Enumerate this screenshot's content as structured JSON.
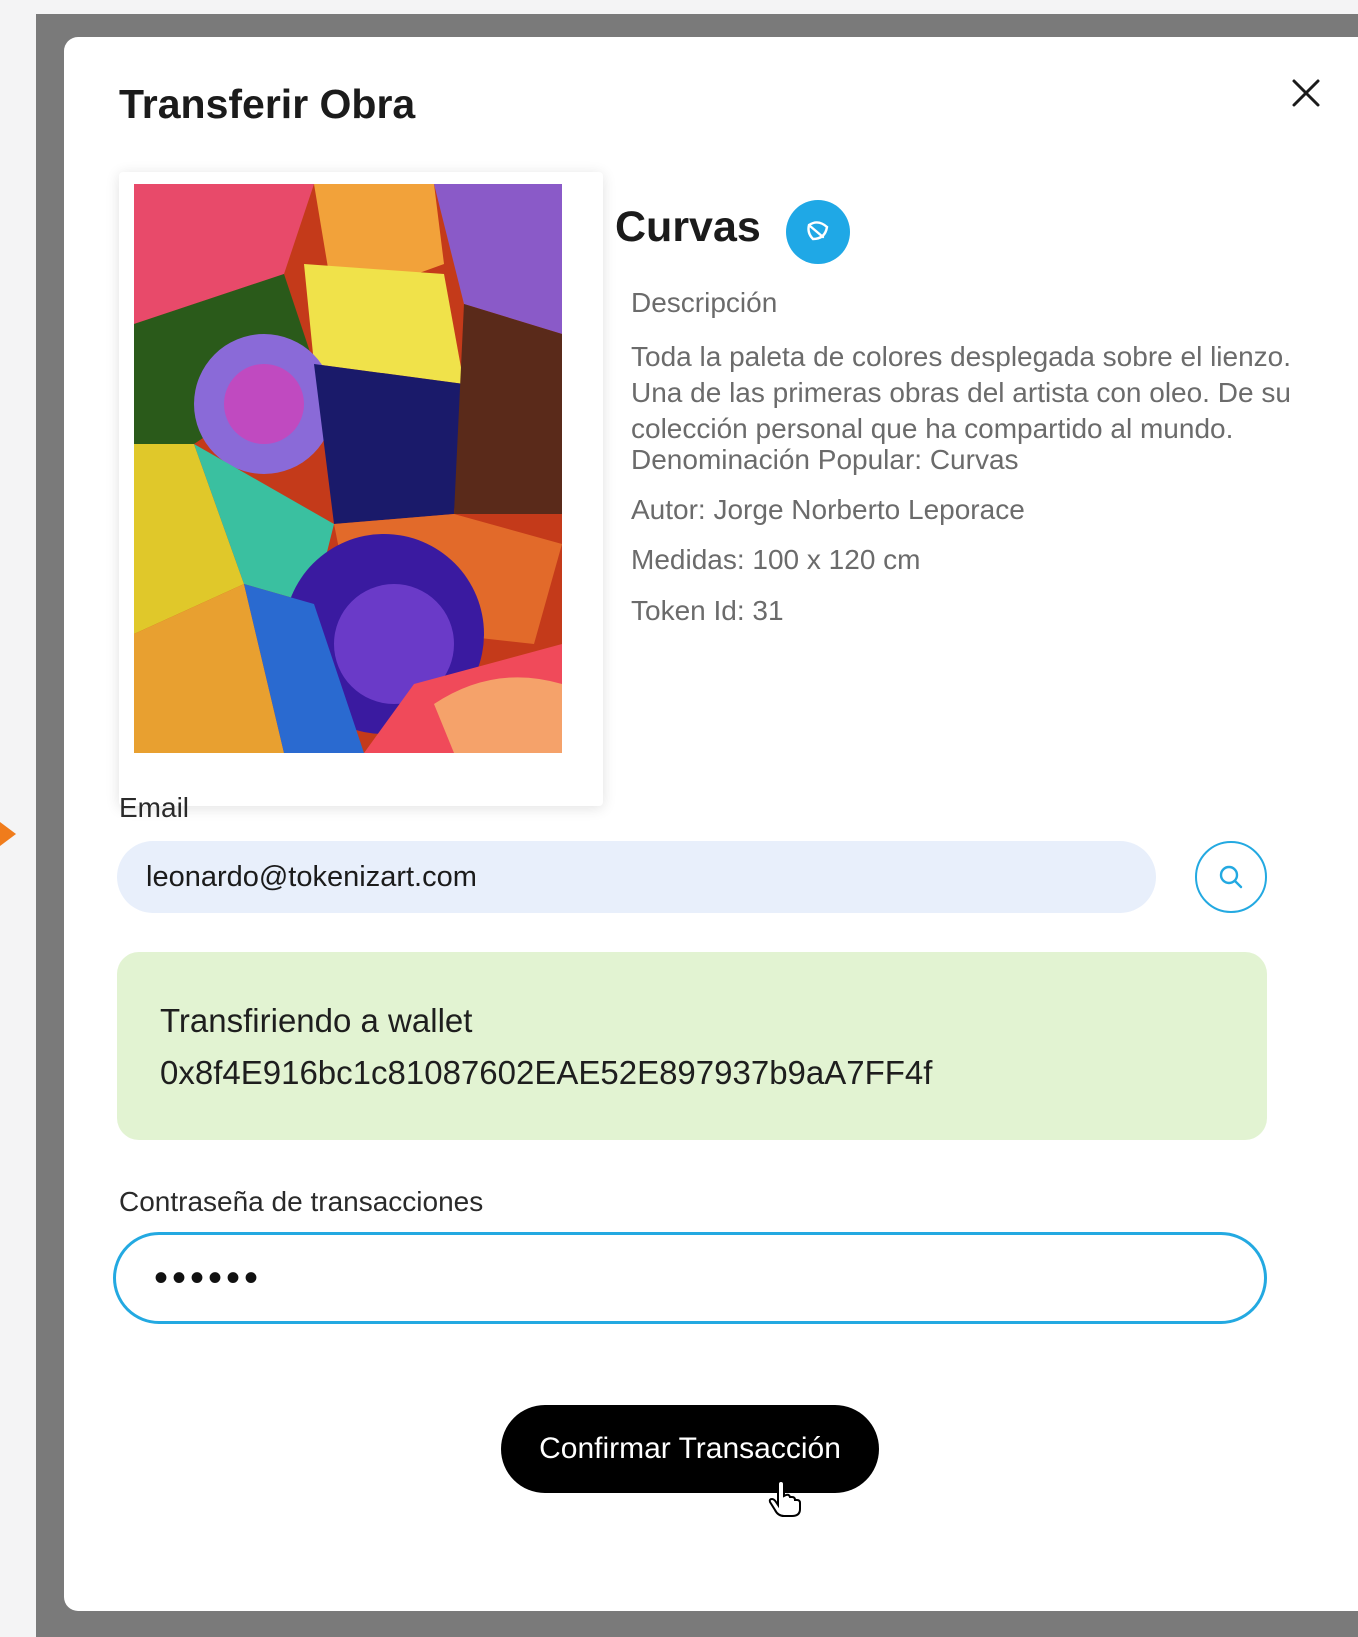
{
  "modal": {
    "title": "Transferir Obra",
    "close_icon": "close-icon"
  },
  "artwork": {
    "title": "Curvas",
    "badge_icon": "leaf-icon",
    "badge_color": "#1fa8e6",
    "description_label": "Descripción",
    "description": "Toda la paleta de colores desplegada sobre el lienzo. Una de las primeras obras del artista con oleo. De su colección personal que ha compartido al mundo.",
    "popular_name": "Denominación Popular: Curvas",
    "author": "Autor: Jorge Norberto Leporace",
    "measures": "Medidas: 100 x 120 cm",
    "token_id": "Token Id: 31"
  },
  "email": {
    "label": "Email",
    "value": "leonardo@tokenizart.com",
    "search_icon": "search-icon"
  },
  "wallet": {
    "title": "Transfiriendo a wallet",
    "address": "0x8f4E916bc1c81087602EAE52E897937b9aA7FF4f",
    "background": "#e2f3d2"
  },
  "password": {
    "label": "Contraseña de transacciones",
    "value": "••••••"
  },
  "actions": {
    "confirm_label": "Confirmar Transacción"
  },
  "colors": {
    "accent": "#23a9e1",
    "primary_button": "#000000"
  }
}
